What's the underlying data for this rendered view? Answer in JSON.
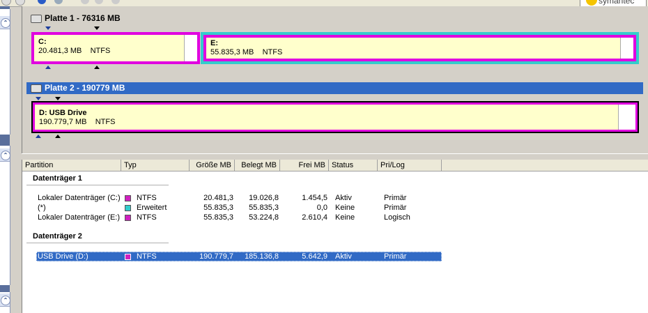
{
  "app": {
    "brand_text": "symantec",
    "accent": "#316ac5",
    "partition_fill": "#ffffcc"
  },
  "disk_map": {
    "disks": [
      {
        "title": "Platte 1 - 76316 MB",
        "selected": false,
        "partitions": [
          {
            "label": "C:",
            "size": "20.481,3 MB",
            "fs": "NTFS",
            "border": "#e000e0",
            "outer": ""
          },
          {
            "label": "E:",
            "size": "55.835,3 MB",
            "fs": "NTFS",
            "border": "#e000e0",
            "outer": "#33cccc"
          }
        ]
      },
      {
        "title": "Platte 2 - 190779 MB",
        "selected": true,
        "partitions": [
          {
            "label": "D:  USB Drive",
            "size": "190.779,7 MB",
            "fs": "NTFS",
            "border": "#e000e0",
            "outer": "#000000"
          }
        ]
      }
    ]
  },
  "list": {
    "columns": [
      "Partition",
      "Typ",
      "Größe MB",
      "Belegt MB",
      "Frei MB",
      "Status",
      "Pri/Log"
    ],
    "groups": [
      {
        "title": "Datenträger 1",
        "rows": [
          {
            "partition": "Lokaler Datenträger (C:)",
            "type": "NTFS",
            "swatch": "#d020c0",
            "size": "20.481,3",
            "used": "19.026,8",
            "free": "1.454,5",
            "status": "Aktiv",
            "prilog": "Primär"
          },
          {
            "partition": "(*)",
            "type": "Erweitert",
            "swatch": "#33cccc",
            "size": "55.835,3",
            "used": "55.835,3",
            "free": "0,0",
            "status": "Keine",
            "prilog": "Primär"
          },
          {
            "partition": "Lokaler Datenträger (E:)",
            "type": "NTFS",
            "swatch": "#d020c0",
            "size": "55.835,3",
            "used": "53.224,8",
            "free": "2.610,4",
            "status": "Keine",
            "prilog": "Logisch"
          }
        ]
      },
      {
        "title": "Datenträger 2",
        "rows": [
          {
            "partition": "USB Drive (D:)",
            "type": "NTFS",
            "swatch": "#d020c0",
            "size": "190.779,7",
            "used": "185.136,8",
            "free": "5.642,9",
            "status": "Aktiv",
            "prilog": "Primär",
            "selected": true
          }
        ]
      }
    ]
  }
}
